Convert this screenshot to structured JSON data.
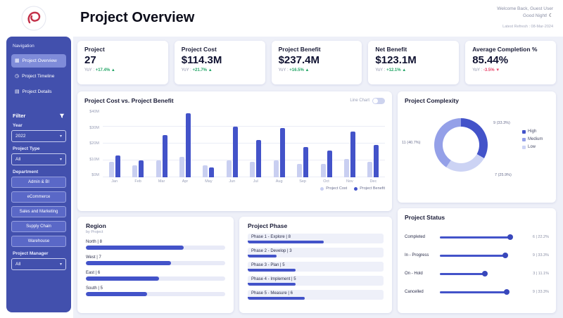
{
  "header": {
    "title": "Project Overview",
    "welcome_line1": "Welcome Back, Guest User",
    "welcome_line2": "Good Night!",
    "moon_icon": "☾",
    "refresh": "Latest Refresh : 08-Mar-2024"
  },
  "ui": {
    "chevron": "▾"
  },
  "sidebar": {
    "nav_label": "Navigation",
    "items": [
      {
        "label": "Project Overview",
        "icon": "▦"
      },
      {
        "label": "Project Timeline",
        "icon": "◷"
      },
      {
        "label": "Project Details",
        "icon": "▤"
      }
    ],
    "filter_label": "Filter",
    "fields": {
      "year_label": "Year",
      "year_value": "2022",
      "type_label": "Project Type",
      "type_value": "All",
      "department_label": "Department",
      "manager_label": "Project Manager",
      "manager_value": "All"
    },
    "departments": [
      "Admin & BI",
      "eCommerce",
      "Sales and Marketing",
      "Supply Chain",
      "Warehouse"
    ]
  },
  "kpis": [
    {
      "title": "Project",
      "value": "27",
      "yoy_label": "YoY :",
      "yoy": "+17.4%",
      "arrow": "▲"
    },
    {
      "title": "Project Cost",
      "value": "$114.3M",
      "yoy_label": "YoY :",
      "yoy": "+21.7%",
      "arrow": "▲"
    },
    {
      "title": "Project Benefit",
      "value": "$237.4M",
      "yoy_label": "YoY :",
      "yoy": "+16.5%",
      "arrow": "▲"
    },
    {
      "title": "Net Benefit",
      "value": "$123.1M",
      "yoy_label": "YoY :",
      "yoy": "+12.1%",
      "arrow": "▲"
    },
    {
      "title": "Average Completion %",
      "value": "85.44%",
      "yoy_label": "YoY :",
      "yoy": "-3.5%",
      "arrow": "▼"
    }
  ],
  "cost_benefit": {
    "title": "Project Cost vs. Project Benefit",
    "toggle_label": "Line Chart"
  },
  "complexity": {
    "title": "Project Complexity"
  },
  "region": {
    "title": "Region",
    "subtitle": "by Project"
  },
  "phase": {
    "title": "Project Phase"
  },
  "status": {
    "title": "Project Status"
  },
  "chart_data": [
    {
      "type": "bar",
      "title": "Project Cost vs. Project Benefit",
      "categories": [
        "Jan",
        "Feb",
        "Mar",
        "Apr",
        "May",
        "Jun",
        "Jul",
        "Aug",
        "Sep",
        "Oct",
        "Nov",
        "Dec"
      ],
      "series": [
        {
          "name": "Project Cost",
          "color": "#c9cff1",
          "values": [
            9,
            7,
            10,
            12,
            7,
            10,
            9,
            10,
            8,
            8,
            11,
            9
          ]
        },
        {
          "name": "Project Benefit",
          "color": "#4353c9",
          "values": [
            13,
            10,
            25,
            38,
            6,
            30,
            22,
            29,
            18,
            16,
            27,
            19
          ]
        }
      ],
      "ylabel": "$M",
      "ylim": [
        0,
        40
      ],
      "yticks": [
        "$40M",
        "$30M",
        "$20M",
        "$10M",
        "$0M"
      ],
      "grid": true,
      "legend_position": "bottom-right"
    },
    {
      "type": "pie",
      "title": "Project Complexity",
      "labels": [
        "High",
        "Medium",
        "Low"
      ],
      "values": [
        9,
        11,
        7
      ],
      "colors": [
        "#4353c9",
        "#94a0e8",
        "#ccd3f4"
      ],
      "callouts": [
        "9 (33.3%)",
        "11 (40.7%)",
        "7 (25.9%)"
      ],
      "legend_position": "right"
    },
    {
      "type": "bar",
      "title": "Region by Project",
      "categories": [
        "North",
        "West",
        "East",
        "South"
      ],
      "values": [
        8,
        7,
        6,
        5
      ]
    },
    {
      "type": "bar",
      "title": "Project Phase",
      "categories": [
        "Phase 1 - Explore",
        "Phase 2 - Develop",
        "Phase 3 - Plan",
        "Phase 4 - Implement",
        "Phase 5 - Measure"
      ],
      "values": [
        8,
        3,
        5,
        5,
        6
      ]
    },
    {
      "type": "bar",
      "title": "Project Status",
      "categories": [
        "Completed",
        "In - Progress",
        "On - Hold",
        "Cancelled"
      ],
      "values": [
        6,
        9,
        3,
        9
      ],
      "value_labels": [
        "6 | 22.2%",
        "9 | 33.3%",
        "3 | 11.1%",
        "9 | 33.3%"
      ],
      "bar_pct": [
        90,
        84,
        58,
        86
      ]
    }
  ]
}
